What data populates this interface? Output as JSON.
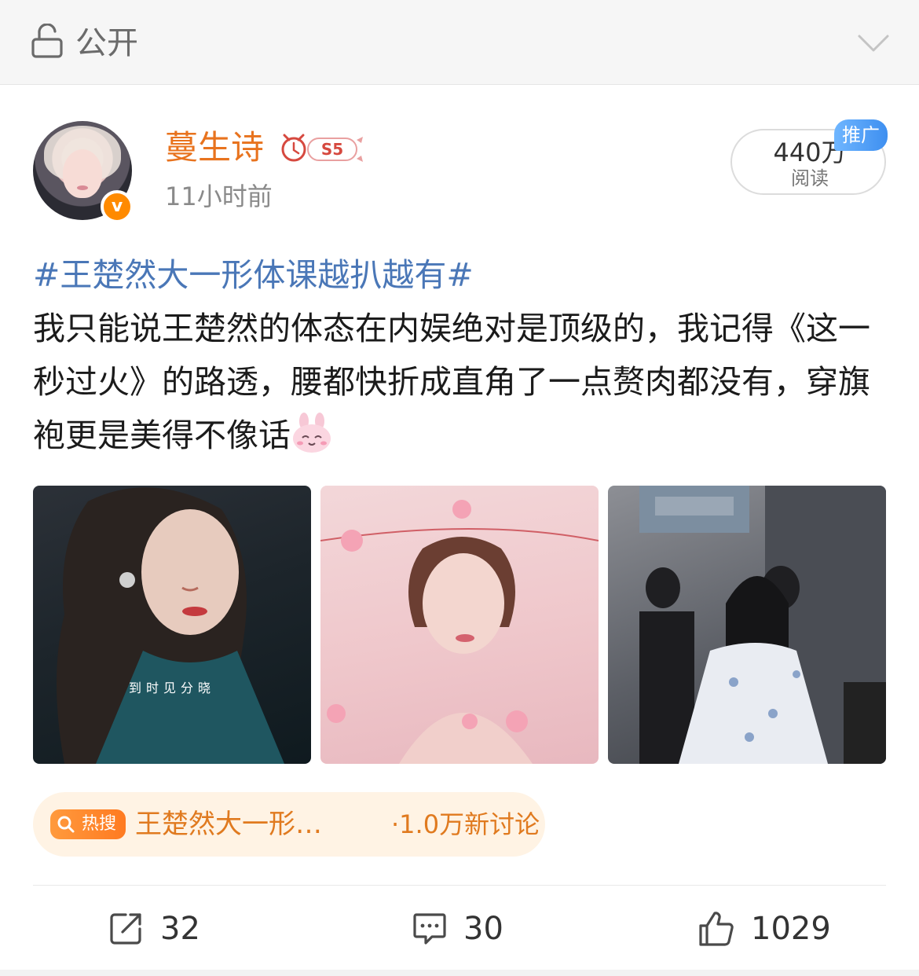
{
  "topbar": {
    "visibility_label": "公开"
  },
  "post": {
    "author": {
      "name": "蔓生诗",
      "level_badge": "S5",
      "time": "11小时前"
    },
    "reads": {
      "count": "440万",
      "label": "阅读",
      "promo_label": "推广"
    },
    "hashtag": "#王楚然大一形体课越扒越有#",
    "body": "我只能说王楚然的体态在内娱绝对是顶级的，我记得《这一秒过火》的路透，腰都快折成直角了一点赘肉都没有，穿旗袍更是美得不像话",
    "photos": [
      {
        "caption": "到时见分晓"
      },
      {
        "caption": ""
      },
      {
        "caption": ""
      }
    ],
    "hot_search": {
      "badge": "热搜",
      "title": "王楚然大一形…",
      "meta": "·1.0万新讨论"
    },
    "actions": {
      "repost": "32",
      "comment": "30",
      "like": "1029"
    }
  },
  "colors": {
    "username": "#e8731e",
    "hashtag": "#4a77b7",
    "hot_bg": "#fff3e4",
    "hot_text": "#e07a1f"
  }
}
